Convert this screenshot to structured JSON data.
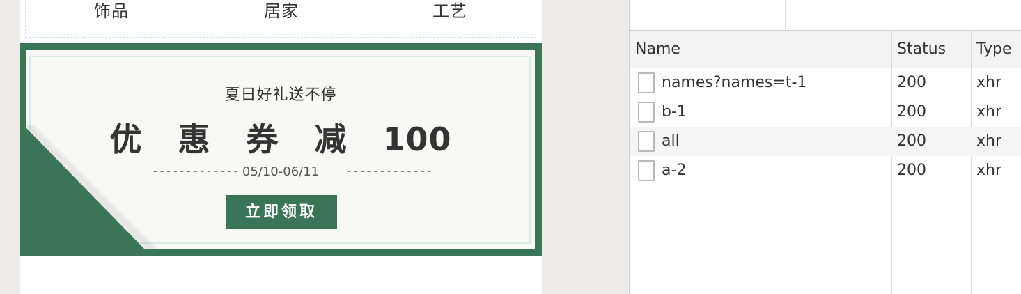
{
  "preview": {
    "categories": [
      "饰品",
      "居家",
      "工艺"
    ],
    "coupon": {
      "subtitle": "夏日好礼送不停",
      "title_prefix": "优 惠 券 减",
      "title_amount": "100",
      "dashes": "-------------",
      "date_range": "05/10-06/11",
      "button_label": "立即领取"
    },
    "colors": {
      "brand_green": "#3a7558",
      "card_bg": "#f8f8f6"
    }
  },
  "network": {
    "columns": [
      "Name",
      "Status",
      "Type"
    ],
    "rows": [
      {
        "name": "names?names=t-1",
        "status": "200",
        "type": "xhr",
        "icon": "document-icon"
      },
      {
        "name": "b-1",
        "status": "200",
        "type": "xhr",
        "icon": "document-icon"
      },
      {
        "name": "all",
        "status": "200",
        "type": "xhr",
        "icon": "document-icon"
      },
      {
        "name": "a-2",
        "status": "200",
        "type": "xhr",
        "icon": "document-icon"
      }
    ]
  }
}
